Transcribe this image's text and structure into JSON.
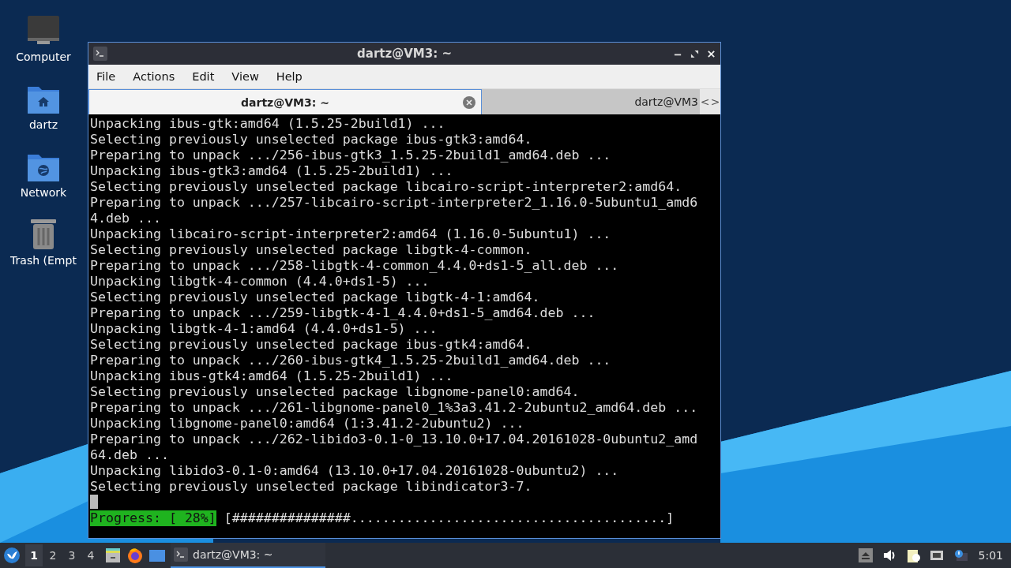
{
  "desktop_icons": [
    {
      "kind": "computer",
      "label": "Computer"
    },
    {
      "kind": "home",
      "label": "dartz"
    },
    {
      "kind": "network",
      "label": "Network"
    },
    {
      "kind": "trash",
      "label": "Trash (Empt"
    }
  ],
  "window": {
    "title": "dartz@VM3: ~",
    "menu": [
      "File",
      "Actions",
      "Edit",
      "View",
      "Help"
    ],
    "tabs": [
      {
        "label": "dartz@VM3: ~",
        "selected": true
      },
      {
        "label": "dartz@VM3",
        "selected": false
      }
    ],
    "tab_scroll": [
      "<",
      ">"
    ],
    "terminal": {
      "lines": [
        "Unpacking ibus-gtk:amd64 (1.5.25-2build1) ...",
        "Selecting previously unselected package ibus-gtk3:amd64.",
        "Preparing to unpack .../256-ibus-gtk3_1.5.25-2build1_amd64.deb ...",
        "Unpacking ibus-gtk3:amd64 (1.5.25-2build1) ...",
        "Selecting previously unselected package libcairo-script-interpreter2:amd64.",
        "Preparing to unpack .../257-libcairo-script-interpreter2_1.16.0-5ubuntu1_amd64.deb ...",
        "Unpacking libcairo-script-interpreter2:amd64 (1.16.0-5ubuntu1) ...",
        "Selecting previously unselected package libgtk-4-common.",
        "Preparing to unpack .../258-libgtk-4-common_4.4.0+ds1-5_all.deb ...",
        "Unpacking libgtk-4-common (4.4.0+ds1-5) ...",
        "Selecting previously unselected package libgtk-4-1:amd64.",
        "Preparing to unpack .../259-libgtk-4-1_4.4.0+ds1-5_amd64.deb ...",
        "Unpacking libgtk-4-1:amd64 (4.4.0+ds1-5) ...",
        "Selecting previously unselected package ibus-gtk4:amd64.",
        "Preparing to unpack .../260-ibus-gtk4_1.5.25-2build1_amd64.deb ...",
        "Unpacking ibus-gtk4:amd64 (1.5.25-2build1) ...",
        "Selecting previously unselected package libgnome-panel0:amd64.",
        "Preparing to unpack .../261-libgnome-panel0_1%3a3.41.2-2ubuntu2_amd64.deb ...",
        "Unpacking libgnome-panel0:amd64 (1:3.41.2-2ubuntu2) ...",
        "Preparing to unpack .../262-libido3-0.1-0_13.10.0+17.04.20161028-0ubuntu2_amd64.deb ...",
        "Unpacking libido3-0.1-0:amd64 (13.10.0+17.04.20161028-0ubuntu2) ...",
        "Selecting previously unselected package libindicator3-7."
      ],
      "progress_label": "Progress: [ 28%]",
      "progress_bar": "[###############........................................]"
    }
  },
  "taskbar": {
    "workspaces": [
      {
        "label": "1",
        "selected": true
      },
      {
        "label": "2",
        "selected": false
      },
      {
        "label": "3",
        "selected": false
      },
      {
        "label": "4",
        "selected": false
      }
    ],
    "launchers": [
      {
        "kind": "files"
      },
      {
        "kind": "browser"
      },
      {
        "kind": "desktop"
      }
    ],
    "tasks": [
      {
        "label": "dartz@VM3: ~",
        "selected": true
      }
    ],
    "tray": [
      {
        "kind": "eject"
      },
      {
        "kind": "volume"
      },
      {
        "kind": "clipboard"
      },
      {
        "kind": "network"
      },
      {
        "kind": "update"
      }
    ],
    "clock": "5:01"
  }
}
